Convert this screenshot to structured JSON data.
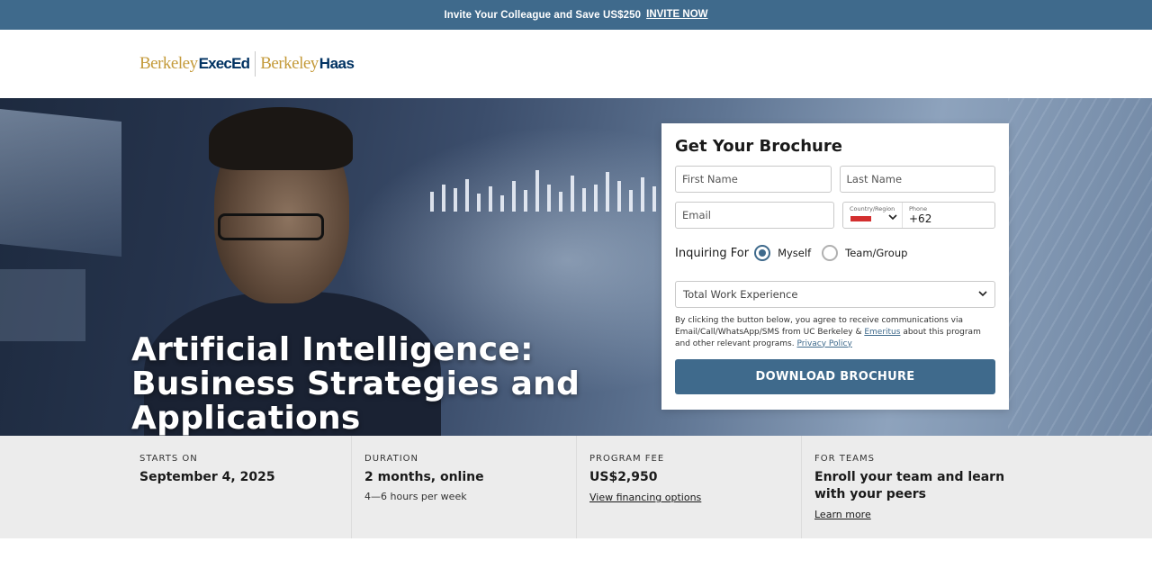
{
  "banner": {
    "promo_text": "Invite Your Colleague and Save US$250",
    "invite_link": "INVITE NOW",
    "background_color": "#3f6a8c"
  },
  "header": {
    "logo": {
      "part1": "Berkeley",
      "part2": "ExecEd",
      "part3": "Berkeley",
      "part4": "Haas"
    }
  },
  "hero": {
    "title": "Artificial Intelligence: Business Strategies and Applications"
  },
  "form": {
    "title": "Get Your Brochure",
    "first_name_placeholder": "First Name",
    "last_name_placeholder": "Last Name",
    "email_placeholder": "Email",
    "country_label": "Country/Region",
    "phone_label": "Phone",
    "phone_code": "+62",
    "inquiring_label": "Inquiring For",
    "options": [
      "Myself",
      "Team/Group"
    ],
    "selected_option": "Myself",
    "work_experience_placeholder": "Total Work Experience",
    "consent_text_1": "By clicking the button below, you agree to receive communications via Email/Call/WhatsApp/SMS from UC Berkeley & ",
    "consent_link_emeritus": "Emeritus",
    "consent_text_2": " about this program and other relevant programs. ",
    "consent_link_privacy": "Privacy Policy",
    "submit_label": "DOWNLOAD BROCHURE",
    "accent_color": "#3f6a8c"
  },
  "info": {
    "starts": {
      "label": "STARTS ON",
      "value": "September 4, 2025"
    },
    "duration": {
      "label": "DURATION",
      "value": "2 months, online",
      "sub": "4—6 hours per week"
    },
    "fee": {
      "label": "PROGRAM FEE",
      "value": "US$2,950",
      "link": "View financing options"
    },
    "teams": {
      "label": "FOR TEAMS",
      "value": "Enroll your team and learn with your peers",
      "link": "Learn more"
    }
  }
}
